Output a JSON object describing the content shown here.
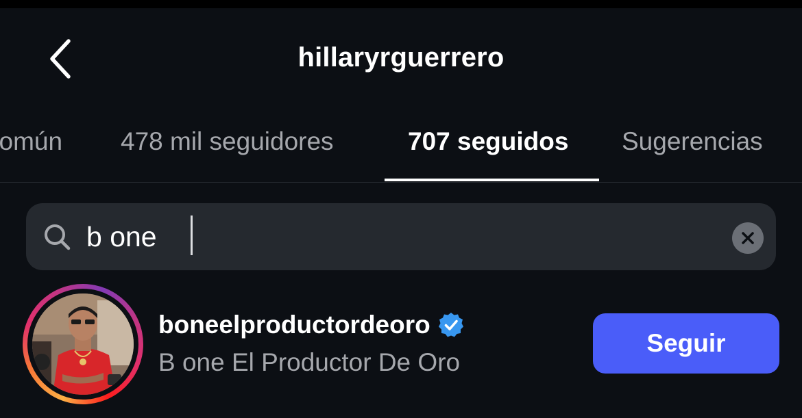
{
  "header": {
    "title": "hillaryrguerrero",
    "back_icon": "chevron-left-icon"
  },
  "tabs": [
    {
      "label": "común",
      "active": false
    },
    {
      "label": "478 mil seguidores",
      "active": false
    },
    {
      "label": "707 seguidos",
      "active": true
    },
    {
      "label": "Sugerencias",
      "active": false
    }
  ],
  "search": {
    "value": "b one",
    "icon": "search-icon",
    "clear_icon": "clear-icon"
  },
  "results": [
    {
      "username": "boneelproductordeoro",
      "verified": true,
      "full_name": "B one El Productor De Oro",
      "follow_label": "Seguir",
      "has_story_ring": true
    }
  ],
  "colors": {
    "background": "#0c0f14",
    "search_background": "#25292f",
    "follow_button": "#4a5df9",
    "verified_badge": "#3897f0",
    "secondary_text": "#a6a8ad"
  }
}
